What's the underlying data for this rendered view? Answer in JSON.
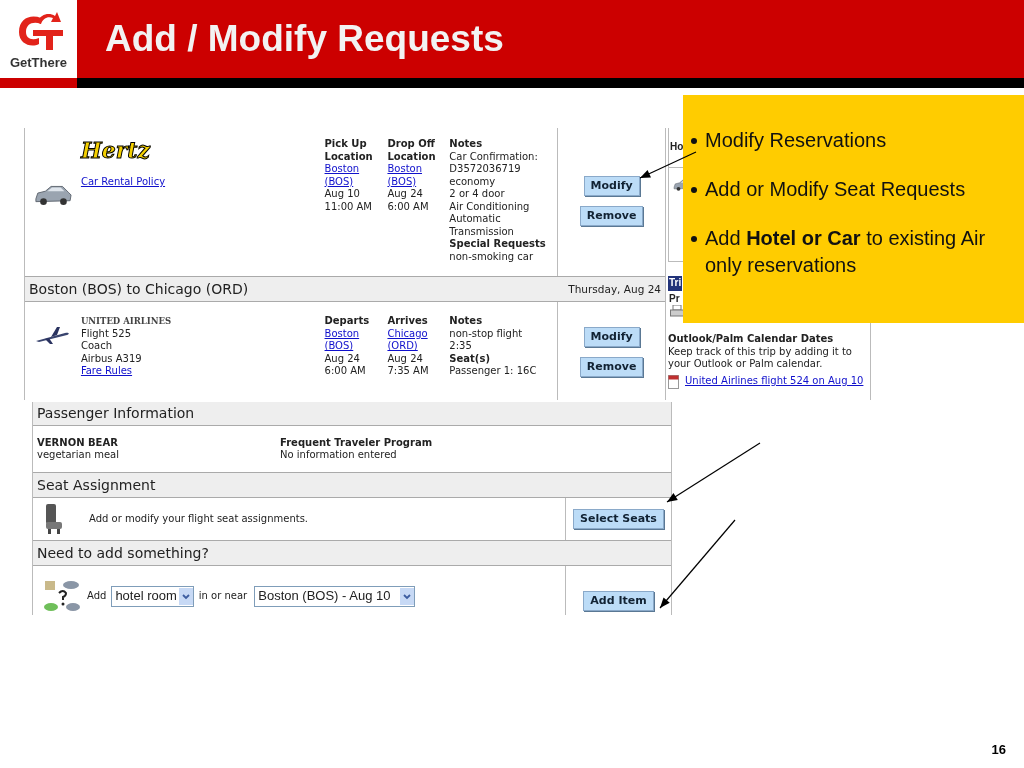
{
  "logo": {
    "text": "GetThere"
  },
  "title": "Add / Modify Requests",
  "car": {
    "brand": "Hertz",
    "policy_link": "Car Rental Policy",
    "columns": [
      {
        "lines": [
          {
            "text": "Pick Up",
            "kind": "heading"
          },
          {
            "text": "Location",
            "kind": "heading"
          },
          {
            "text": "Boston",
            "kind": "link"
          },
          {
            "text": "(BOS)",
            "kind": "link"
          },
          {
            "text": "Aug 10",
            "kind": "text"
          },
          {
            "text": "11:00 AM",
            "kind": "text"
          }
        ]
      },
      {
        "lines": [
          {
            "text": "Drop Off",
            "kind": "heading"
          },
          {
            "text": "Location",
            "kind": "heading"
          },
          {
            "text": "Boston",
            "kind": "link"
          },
          {
            "text": "(BOS)",
            "kind": "link"
          },
          {
            "text": "Aug 24",
            "kind": "text"
          },
          {
            "text": "6:00 AM",
            "kind": "text"
          }
        ]
      },
      {
        "lines": [
          {
            "text": "Notes",
            "kind": "heading"
          },
          {
            "text": "Car Confirmation:",
            "kind": "text"
          },
          {
            "text": "D3572036719",
            "kind": "text"
          },
          {
            "text": "economy",
            "kind": "text"
          },
          {
            "text": "2 or 4 door",
            "kind": "text"
          },
          {
            "text": "Air Conditioning",
            "kind": "text"
          },
          {
            "text": "Automatic",
            "kind": "text"
          },
          {
            "text": "Transmission",
            "kind": "text"
          },
          {
            "text": "Special Requests",
            "kind": "heading"
          },
          {
            "text": "non-smoking car",
            "kind": "text"
          }
        ]
      }
    ],
    "buttons": [
      "Modify",
      "Remove"
    ]
  },
  "segment": {
    "route": "Boston (BOS) to Chicago (ORD)",
    "date": "Thursday, Aug 24"
  },
  "flight": {
    "airline": "UNITED AIRLINES",
    "info": [
      "Flight 525",
      "Coach",
      "Airbus A319"
    ],
    "fare_link": "Fare Rules",
    "columns": [
      {
        "lines": [
          {
            "text": "Departs",
            "kind": "heading"
          },
          {
            "text": "Boston",
            "kind": "link"
          },
          {
            "text": "(BOS)",
            "kind": "link"
          },
          {
            "text": "Aug 24",
            "kind": "text"
          },
          {
            "text": "6:00 AM",
            "kind": "text"
          }
        ]
      },
      {
        "lines": [
          {
            "text": "Arrives",
            "kind": "heading"
          },
          {
            "text": "Chicago",
            "kind": "link"
          },
          {
            "text": "(ORD)",
            "kind": "link"
          },
          {
            "text": "Aug 24",
            "kind": "text"
          },
          {
            "text": "7:35 AM",
            "kind": "text"
          }
        ]
      },
      {
        "lines": [
          {
            "text": "Notes",
            "kind": "heading"
          },
          {
            "text": "non-stop flight",
            "kind": "text"
          },
          {
            "text": "2:35",
            "kind": "text"
          },
          {
            "text": "Seat(s)",
            "kind": "heading"
          },
          {
            "text": "Passenger 1: 16C",
            "kind": "text"
          }
        ]
      }
    ],
    "buttons": [
      "Modify",
      "Remove"
    ]
  },
  "side_panel": {
    "cut_heading": "Ho",
    "trip_tab": "Tri",
    "cut_label": "Pr",
    "calendar_heading": "Outlook/Palm Calendar Dates",
    "calendar_text": [
      "Keep track of this trip by adding it to",
      "your Outlook or Palm calendar."
    ],
    "calendar_link": "United Airlines flight 524 on Aug 10"
  },
  "passenger": {
    "heading": "Passenger Information",
    "name": "VERNON BEAR",
    "meal": "vegetarian meal",
    "ftp_heading": "Frequent Traveler Program",
    "ftp_value": "No information entered"
  },
  "seat": {
    "heading": "Seat Assignment",
    "text": "Add or modify your flight seat assignments.",
    "button": "Select Seats"
  },
  "add": {
    "heading": "Need to add something?",
    "add_label": "Add",
    "item_select": "hotel room",
    "near_label": "in or near",
    "place_select": "Boston (BOS) - Aug 10",
    "button": "Add Item"
  },
  "callout": [
    "Modify Reservations",
    "Add or Modify Seat Requests",
    "Add **Hotel or Car** to existing Air only reservations"
  ],
  "page_number": "16"
}
